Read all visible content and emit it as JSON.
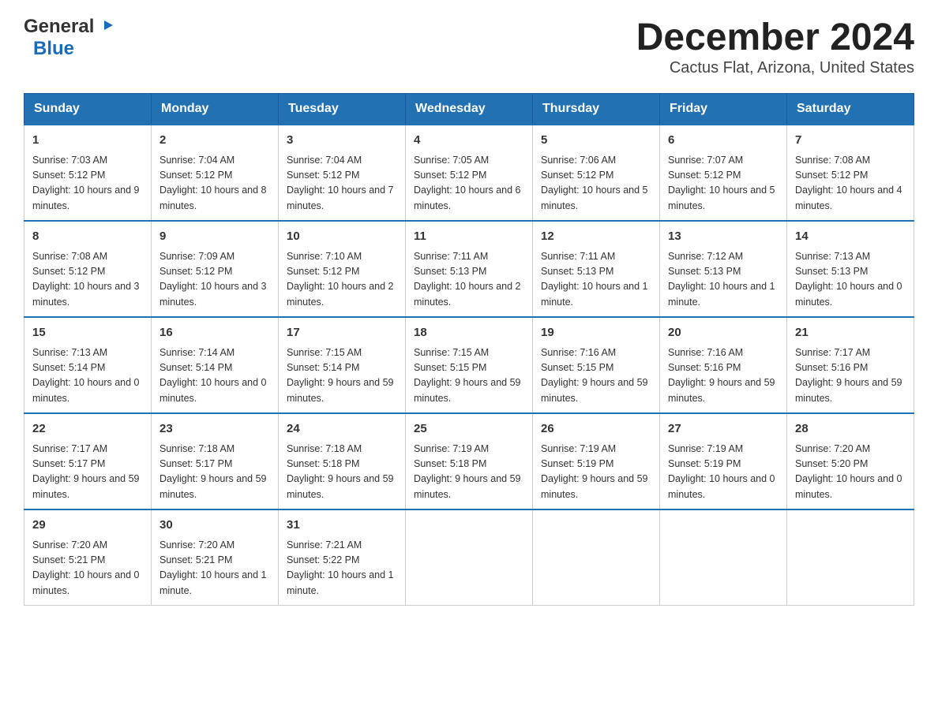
{
  "header": {
    "logo_general": "General",
    "logo_blue": "Blue",
    "month_title": "December 2024",
    "location": "Cactus Flat, Arizona, United States"
  },
  "days_of_week": [
    "Sunday",
    "Monday",
    "Tuesday",
    "Wednesday",
    "Thursday",
    "Friday",
    "Saturday"
  ],
  "weeks": [
    [
      {
        "date": "1",
        "sunrise": "7:03 AM",
        "sunset": "5:12 PM",
        "daylight": "10 hours and 9 minutes."
      },
      {
        "date": "2",
        "sunrise": "7:04 AM",
        "sunset": "5:12 PM",
        "daylight": "10 hours and 8 minutes."
      },
      {
        "date": "3",
        "sunrise": "7:04 AM",
        "sunset": "5:12 PM",
        "daylight": "10 hours and 7 minutes."
      },
      {
        "date": "4",
        "sunrise": "7:05 AM",
        "sunset": "5:12 PM",
        "daylight": "10 hours and 6 minutes."
      },
      {
        "date": "5",
        "sunrise": "7:06 AM",
        "sunset": "5:12 PM",
        "daylight": "10 hours and 5 minutes."
      },
      {
        "date": "6",
        "sunrise": "7:07 AM",
        "sunset": "5:12 PM",
        "daylight": "10 hours and 5 minutes."
      },
      {
        "date": "7",
        "sunrise": "7:08 AM",
        "sunset": "5:12 PM",
        "daylight": "10 hours and 4 minutes."
      }
    ],
    [
      {
        "date": "8",
        "sunrise": "7:08 AM",
        "sunset": "5:12 PM",
        "daylight": "10 hours and 3 minutes."
      },
      {
        "date": "9",
        "sunrise": "7:09 AM",
        "sunset": "5:12 PM",
        "daylight": "10 hours and 3 minutes."
      },
      {
        "date": "10",
        "sunrise": "7:10 AM",
        "sunset": "5:12 PM",
        "daylight": "10 hours and 2 minutes."
      },
      {
        "date": "11",
        "sunrise": "7:11 AM",
        "sunset": "5:13 PM",
        "daylight": "10 hours and 2 minutes."
      },
      {
        "date": "12",
        "sunrise": "7:11 AM",
        "sunset": "5:13 PM",
        "daylight": "10 hours and 1 minute."
      },
      {
        "date": "13",
        "sunrise": "7:12 AM",
        "sunset": "5:13 PM",
        "daylight": "10 hours and 1 minute."
      },
      {
        "date": "14",
        "sunrise": "7:13 AM",
        "sunset": "5:13 PM",
        "daylight": "10 hours and 0 minutes."
      }
    ],
    [
      {
        "date": "15",
        "sunrise": "7:13 AM",
        "sunset": "5:14 PM",
        "daylight": "10 hours and 0 minutes."
      },
      {
        "date": "16",
        "sunrise": "7:14 AM",
        "sunset": "5:14 PM",
        "daylight": "10 hours and 0 minutes."
      },
      {
        "date": "17",
        "sunrise": "7:15 AM",
        "sunset": "5:14 PM",
        "daylight": "9 hours and 59 minutes."
      },
      {
        "date": "18",
        "sunrise": "7:15 AM",
        "sunset": "5:15 PM",
        "daylight": "9 hours and 59 minutes."
      },
      {
        "date": "19",
        "sunrise": "7:16 AM",
        "sunset": "5:15 PM",
        "daylight": "9 hours and 59 minutes."
      },
      {
        "date": "20",
        "sunrise": "7:16 AM",
        "sunset": "5:16 PM",
        "daylight": "9 hours and 59 minutes."
      },
      {
        "date": "21",
        "sunrise": "7:17 AM",
        "sunset": "5:16 PM",
        "daylight": "9 hours and 59 minutes."
      }
    ],
    [
      {
        "date": "22",
        "sunrise": "7:17 AM",
        "sunset": "5:17 PM",
        "daylight": "9 hours and 59 minutes."
      },
      {
        "date": "23",
        "sunrise": "7:18 AM",
        "sunset": "5:17 PM",
        "daylight": "9 hours and 59 minutes."
      },
      {
        "date": "24",
        "sunrise": "7:18 AM",
        "sunset": "5:18 PM",
        "daylight": "9 hours and 59 minutes."
      },
      {
        "date": "25",
        "sunrise": "7:19 AM",
        "sunset": "5:18 PM",
        "daylight": "9 hours and 59 minutes."
      },
      {
        "date": "26",
        "sunrise": "7:19 AM",
        "sunset": "5:19 PM",
        "daylight": "9 hours and 59 minutes."
      },
      {
        "date": "27",
        "sunrise": "7:19 AM",
        "sunset": "5:19 PM",
        "daylight": "10 hours and 0 minutes."
      },
      {
        "date": "28",
        "sunrise": "7:20 AM",
        "sunset": "5:20 PM",
        "daylight": "10 hours and 0 minutes."
      }
    ],
    [
      {
        "date": "29",
        "sunrise": "7:20 AM",
        "sunset": "5:21 PM",
        "daylight": "10 hours and 0 minutes."
      },
      {
        "date": "30",
        "sunrise": "7:20 AM",
        "sunset": "5:21 PM",
        "daylight": "10 hours and 1 minute."
      },
      {
        "date": "31",
        "sunrise": "7:21 AM",
        "sunset": "5:22 PM",
        "daylight": "10 hours and 1 minute."
      },
      null,
      null,
      null,
      null
    ]
  ]
}
